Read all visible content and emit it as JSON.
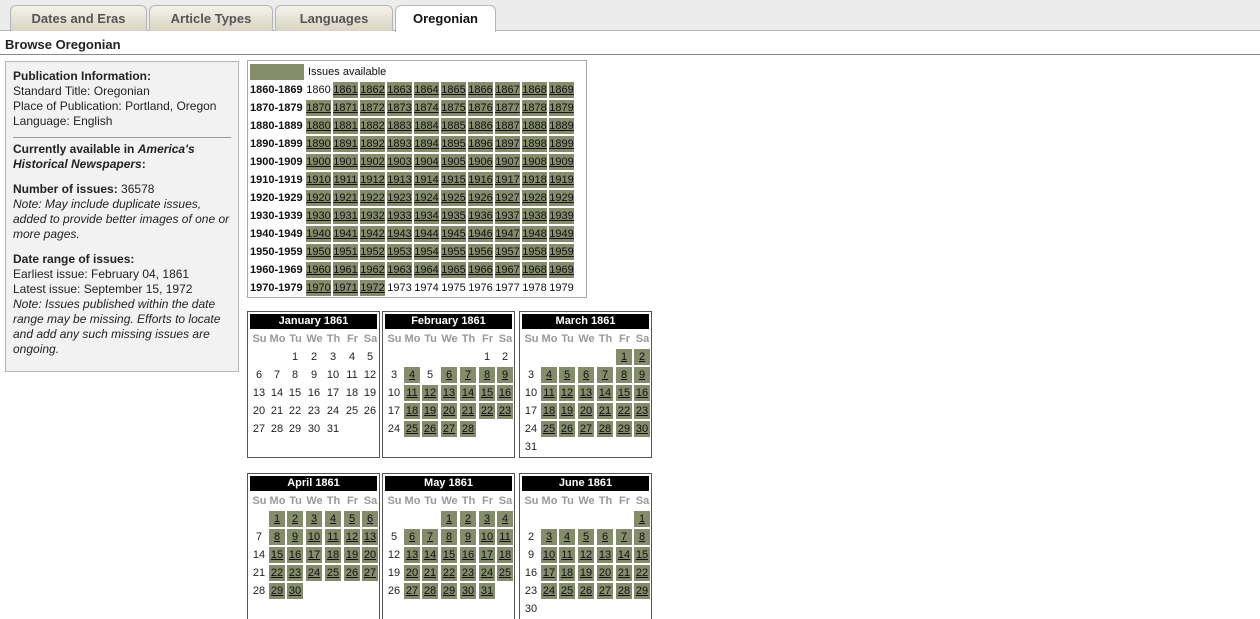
{
  "tabs": [
    "Dates and Eras",
    "Article Types",
    "Languages",
    "Oregonian"
  ],
  "active_tab": 3,
  "page_title": "Browse Oregonian",
  "info": {
    "pub_heading": "Publication Information:",
    "standard_title_label": "Standard Title:",
    "standard_title": "Oregonian",
    "place_label": "Place of Publication:",
    "place": "Portland, Oregon",
    "language_label": "Language:",
    "language": "English",
    "available_prefix": "Currently available in",
    "available_source": "America's Historical Newspapers",
    "available_suffix": ":",
    "issues_label": "Number of issues:",
    "issues_count": "36578",
    "issues_note": "Note: May include duplicate issues, added to provide better images of one or more pages.",
    "range_label": "Date range of issues:",
    "earliest": "Earliest issue: February 04, 1861",
    "latest": "Latest issue: September 15, 1972",
    "range_note": "Note: Issues published within the date range may be missing. Efforts to locate and add any such missing issues are ongoing."
  },
  "legend_label": "Issues available",
  "decades": [
    {
      "label": "1860-1869",
      "start": 1860,
      "available": [
        1861,
        1862,
        1863,
        1864,
        1865,
        1866,
        1867,
        1868,
        1869
      ]
    },
    {
      "label": "1870-1879",
      "start": 1870,
      "available": [
        1870,
        1871,
        1872,
        1873,
        1874,
        1875,
        1876,
        1877,
        1878,
        1879
      ]
    },
    {
      "label": "1880-1889",
      "start": 1880,
      "available": [
        1880,
        1881,
        1882,
        1883,
        1884,
        1885,
        1886,
        1887,
        1888,
        1889
      ]
    },
    {
      "label": "1890-1899",
      "start": 1890,
      "available": [
        1890,
        1891,
        1892,
        1893,
        1894,
        1895,
        1896,
        1897,
        1898,
        1899
      ]
    },
    {
      "label": "1900-1909",
      "start": 1900,
      "available": [
        1900,
        1901,
        1902,
        1903,
        1904,
        1905,
        1906,
        1907,
        1908,
        1909
      ]
    },
    {
      "label": "1910-1919",
      "start": 1910,
      "available": [
        1910,
        1911,
        1912,
        1913,
        1914,
        1915,
        1916,
        1917,
        1918,
        1919
      ]
    },
    {
      "label": "1920-1929",
      "start": 1920,
      "available": [
        1920,
        1921,
        1922,
        1923,
        1924,
        1925,
        1926,
        1927,
        1928,
        1929
      ]
    },
    {
      "label": "1930-1939",
      "start": 1930,
      "available": [
        1930,
        1931,
        1932,
        1933,
        1934,
        1935,
        1936,
        1937,
        1938,
        1939
      ]
    },
    {
      "label": "1940-1949",
      "start": 1940,
      "available": [
        1940,
        1941,
        1942,
        1943,
        1944,
        1945,
        1946,
        1947,
        1948,
        1949
      ]
    },
    {
      "label": "1950-1959",
      "start": 1950,
      "available": [
        1950,
        1951,
        1952,
        1953,
        1954,
        1955,
        1956,
        1957,
        1958,
        1959
      ]
    },
    {
      "label": "1960-1969",
      "start": 1960,
      "available": [
        1960,
        1961,
        1962,
        1963,
        1964,
        1965,
        1966,
        1967,
        1968,
        1969
      ]
    },
    {
      "label": "1970-1979",
      "start": 1970,
      "available": [
        1970,
        1971,
        1972
      ]
    }
  ],
  "weekdays": [
    "Su",
    "Mo",
    "Tu",
    "We",
    "Th",
    "Fr",
    "Sa"
  ],
  "months": [
    {
      "title": "January 1861",
      "first_weekday": 2,
      "days": 31,
      "available": []
    },
    {
      "title": "February 1861",
      "first_weekday": 5,
      "days": 28,
      "available": [
        4,
        6,
        7,
        8,
        9,
        11,
        12,
        13,
        14,
        15,
        16,
        18,
        19,
        20,
        21,
        22,
        23,
        25,
        26,
        27,
        28
      ]
    },
    {
      "title": "March 1861",
      "first_weekday": 5,
      "days": 31,
      "available": [
        1,
        2,
        4,
        5,
        6,
        7,
        8,
        9,
        11,
        12,
        13,
        14,
        15,
        16,
        18,
        19,
        20,
        21,
        22,
        23,
        25,
        26,
        27,
        28,
        29,
        30
      ]
    },
    {
      "title": "April 1861",
      "first_weekday": 1,
      "days": 30,
      "available": [
        1,
        2,
        3,
        4,
        5,
        6,
        8,
        9,
        10,
        11,
        12,
        13,
        15,
        16,
        17,
        18,
        19,
        20,
        22,
        23,
        24,
        25,
        26,
        27,
        29,
        30
      ]
    },
    {
      "title": "May 1861",
      "first_weekday": 3,
      "days": 31,
      "available": [
        1,
        2,
        3,
        4,
        6,
        7,
        8,
        9,
        10,
        11,
        13,
        14,
        15,
        16,
        17,
        18,
        20,
        21,
        22,
        23,
        24,
        25,
        27,
        28,
        29,
        30,
        31
      ]
    },
    {
      "title": "June 1861",
      "first_weekday": 6,
      "days": 30,
      "available": [
        1,
        3,
        4,
        5,
        6,
        7,
        8,
        10,
        11,
        12,
        13,
        14,
        15,
        17,
        18,
        19,
        20,
        21,
        22,
        24,
        25,
        26,
        27,
        28,
        29
      ]
    }
  ]
}
